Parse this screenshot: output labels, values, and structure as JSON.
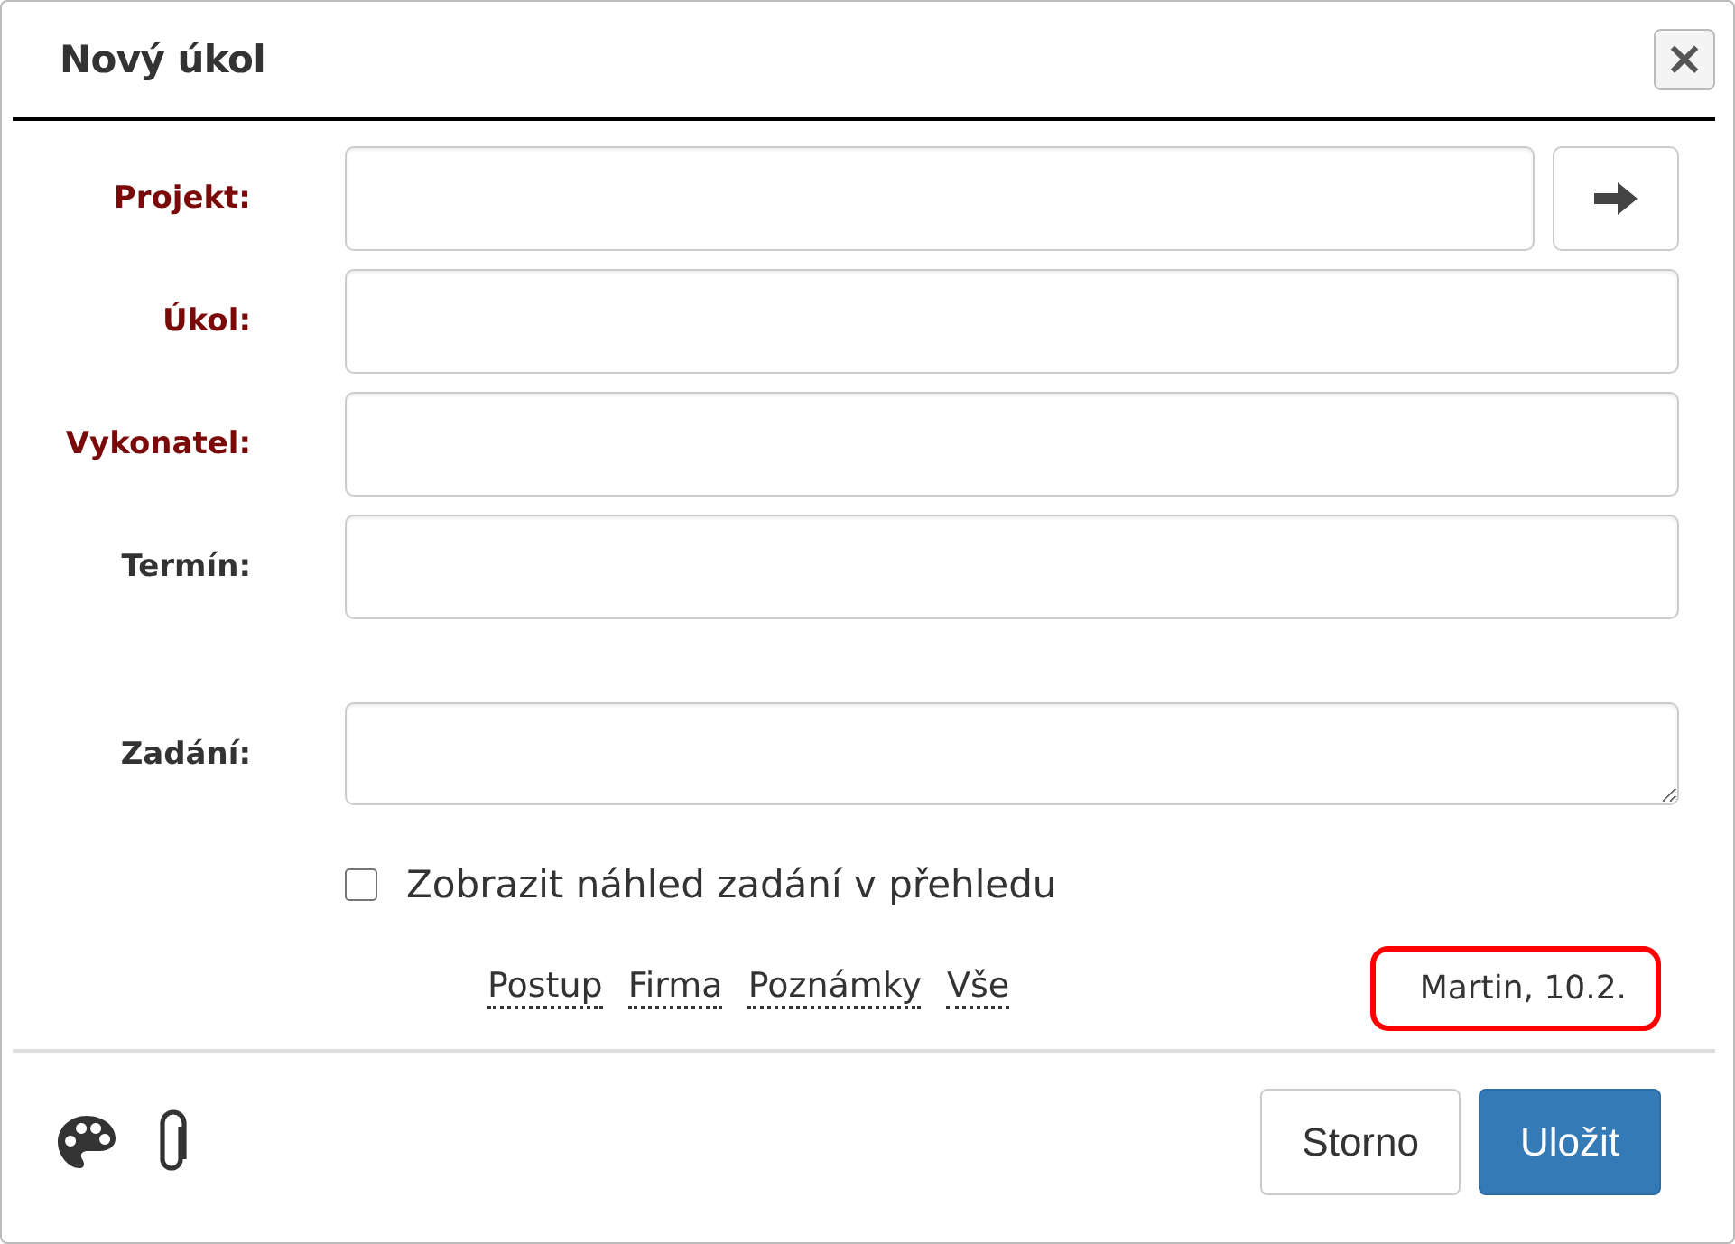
{
  "dialog": {
    "title": "Nový úkol",
    "close_label": "×"
  },
  "fields": [
    {
      "label": "Projekt:",
      "required": true,
      "kind": "input",
      "has_go_button": true
    },
    {
      "label": "Úkol:",
      "required": true,
      "kind": "input",
      "has_go_button": false
    },
    {
      "label": "Vykonatel:",
      "required": true,
      "kind": "input",
      "has_go_button": false
    },
    {
      "label": "Termín:",
      "required": false,
      "kind": "input",
      "has_go_button": false
    },
    {
      "label": "Zadání:",
      "required": false,
      "kind": "textarea",
      "has_go_button": false
    }
  ],
  "preview_checkbox": {
    "label": "Zobrazit náhled zadání v přehledu",
    "checked": false
  },
  "links": [
    "Postup",
    "Firma",
    "Poznámky",
    "Vše"
  ],
  "author_stamp": {
    "text": "Martin, 10.2.",
    "highlighted": true
  },
  "buttons": [
    {
      "label": "Storno",
      "primary": false
    },
    {
      "label": "Uložit",
      "primary": true
    }
  ]
}
